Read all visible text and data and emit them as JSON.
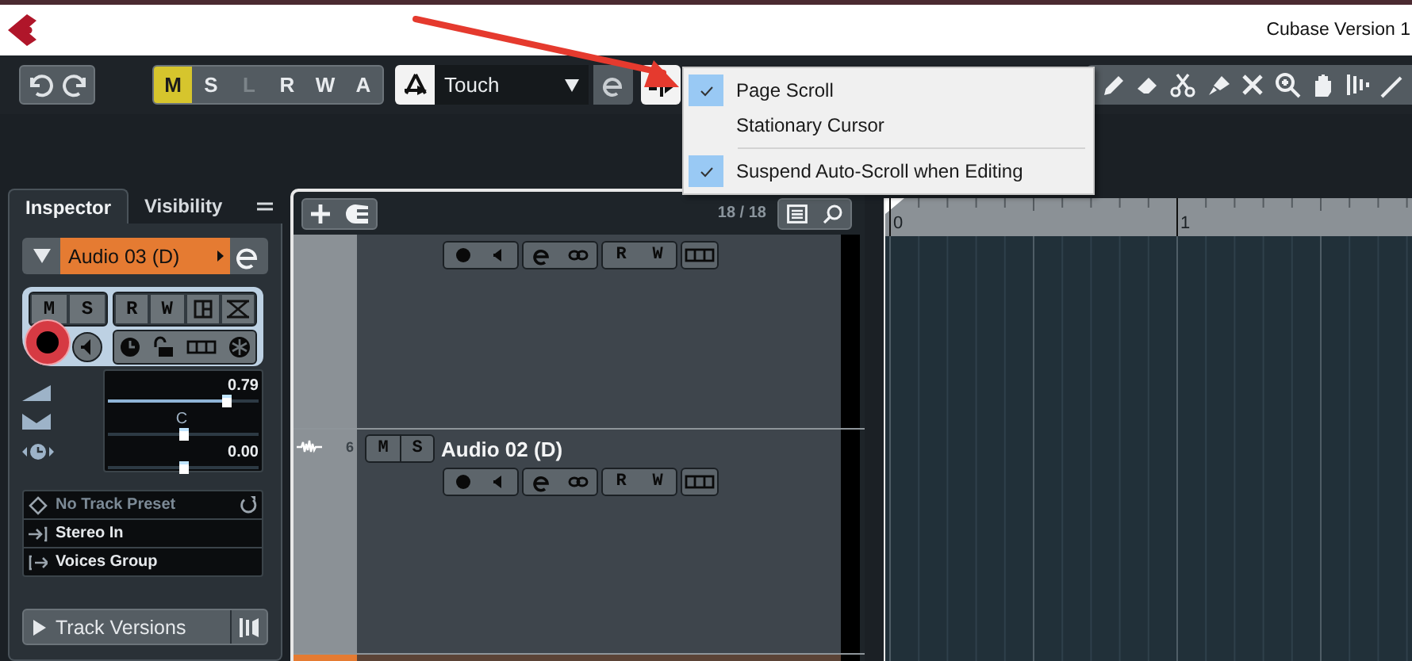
{
  "window": {
    "title": "Cubase Version 1"
  },
  "toolbar": {
    "track_buttons": [
      {
        "label": "M",
        "on": true,
        "disabled": false
      },
      {
        "label": "S",
        "on": false,
        "disabled": false
      },
      {
        "label": "L",
        "on": false,
        "disabled": true
      },
      {
        "label": "R",
        "on": false,
        "disabled": false
      },
      {
        "label": "W",
        "on": false,
        "disabled": false
      },
      {
        "label": "A",
        "on": false,
        "disabled": false
      }
    ],
    "automation_mode": {
      "value": "Touch"
    }
  },
  "scroll_menu": {
    "items": [
      {
        "kind": "option",
        "label": "Page Scroll",
        "checked": true
      },
      {
        "kind": "option",
        "label": "Stationary Cursor",
        "checked": false
      },
      {
        "kind": "separator"
      },
      {
        "kind": "option",
        "label": "Suspend Auto-Scroll when Editing",
        "checked": true
      }
    ]
  },
  "inspector": {
    "tabs": [
      {
        "label": "Inspector",
        "selected": true
      },
      {
        "label": "Visibility",
        "selected": false
      }
    ],
    "track_name": "Audio 03 (D)",
    "buttons": [
      "M",
      "S",
      "R",
      "W"
    ],
    "volume": {
      "reading": "0.79",
      "level": 0.79
    },
    "pan": {
      "reading": "C",
      "level": 0.5
    },
    "delay": {
      "reading": "0.00",
      "level": 0.5
    },
    "preset": "No Track Preset",
    "input": "Stereo In",
    "output": "Voices Group",
    "track_versions": "Track Versions"
  },
  "track_list": {
    "count": "18 / 18",
    "tracks": [
      {
        "kind": "continued",
        "selected": false,
        "automation_buttons": [
          "R",
          "W"
        ]
      },
      {
        "kind": "header",
        "selected": false,
        "number": "6",
        "name": "Audio 02 (D)",
        "header_buttons": [
          "M",
          "S"
        ],
        "automation_buttons": [
          "R",
          "W"
        ]
      },
      {
        "kind": "cut",
        "selected": true
      }
    ]
  },
  "ruler": {
    "marks": [
      "0",
      "1"
    ]
  }
}
